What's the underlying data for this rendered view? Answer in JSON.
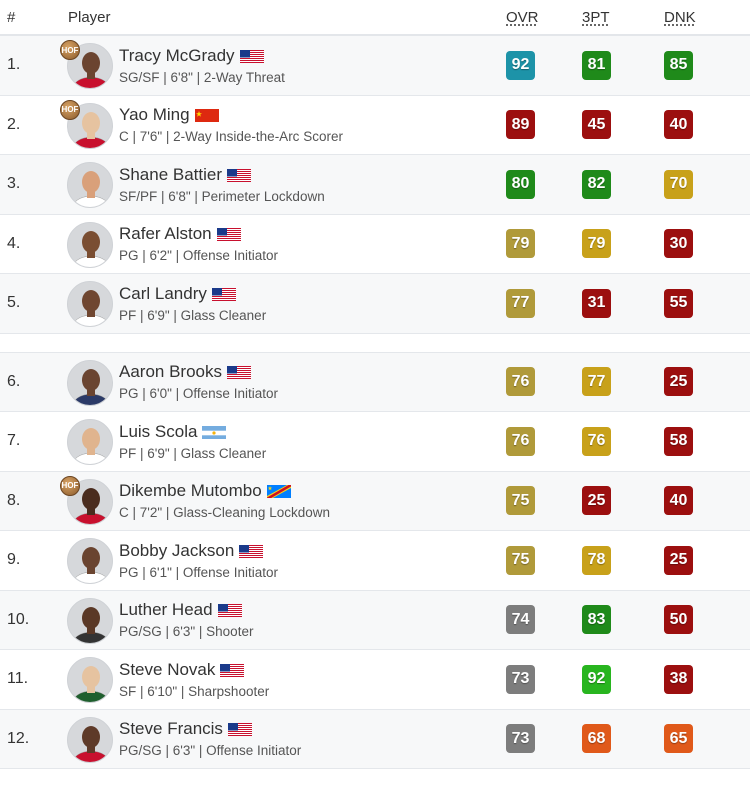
{
  "header": {
    "num": "#",
    "player": "Player",
    "ovr": "OVR",
    "threept": "3PT",
    "dnk": "DNK"
  },
  "colors": {
    "teal": "#1d93a8",
    "darkred": "#9c0f0f",
    "green": "#1f8a1a",
    "brightgreen": "#28b51f",
    "gold": "#b09a3a",
    "yellow": "#c8a11a",
    "gray": "#7d7d7d",
    "orange": "#e0591a"
  },
  "players": [
    {
      "rank": "1.",
      "name": "Tracy McGrady",
      "flag": "usa",
      "hof": true,
      "desc": "SG/SF | 6'8\" | 2-Way Threat",
      "ovr": "92",
      "ovr_c": "teal",
      "tpt": "81",
      "tpt_c": "green",
      "dnk": "85",
      "dnk_c": "green",
      "skin": "#6b4430",
      "jersey": "#c8102e"
    },
    {
      "rank": "2.",
      "name": "Yao Ming",
      "flag": "china",
      "hof": true,
      "desc": "C | 7'6\" | 2-Way Inside-the-Arc Scorer",
      "ovr": "89",
      "ovr_c": "darkred",
      "tpt": "45",
      "tpt_c": "darkred",
      "dnk": "40",
      "dnk_c": "darkred",
      "skin": "#e6c3a0",
      "jersey": "#c8102e"
    },
    {
      "rank": "3.",
      "name": "Shane Battier",
      "flag": "usa",
      "hof": false,
      "desc": "SF/PF | 6'8\" | Perimeter Lockdown",
      "ovr": "80",
      "ovr_c": "green",
      "tpt": "82",
      "tpt_c": "green",
      "dnk": "70",
      "dnk_c": "yellow",
      "skin": "#d9a07a",
      "jersey": "#ffffff"
    },
    {
      "rank": "4.",
      "name": "Rafer Alston",
      "flag": "usa",
      "hof": false,
      "desc": "PG | 6'2\" | Offense Initiator",
      "ovr": "79",
      "ovr_c": "gold",
      "tpt": "79",
      "tpt_c": "yellow",
      "dnk": "30",
      "dnk_c": "darkred",
      "skin": "#7a4e32",
      "jersey": "#ffffff"
    },
    {
      "rank": "5.",
      "name": "Carl Landry",
      "flag": "usa",
      "hof": false,
      "desc": "PF | 6'9\" | Glass Cleaner",
      "ovr": "77",
      "ovr_c": "gold",
      "tpt": "31",
      "tpt_c": "darkred",
      "dnk": "55",
      "dnk_c": "darkred",
      "skin": "#6f4630",
      "jersey": "#ffffff"
    },
    {
      "rank": "6.",
      "name": "Aaron Brooks",
      "flag": "usa",
      "hof": false,
      "desc": "PG | 6'0\" | Offense Initiator",
      "ovr": "76",
      "ovr_c": "gold",
      "tpt": "77",
      "tpt_c": "yellow",
      "dnk": "25",
      "dnk_c": "darkred",
      "skin": "#6a4430",
      "jersey": "#2b3a67"
    },
    {
      "rank": "7.",
      "name": "Luis Scola",
      "flag": "argentina",
      "hof": false,
      "desc": "PF | 6'9\" | Glass Cleaner",
      "ovr": "76",
      "ovr_c": "gold",
      "tpt": "76",
      "tpt_c": "yellow",
      "dnk": "58",
      "dnk_c": "darkred",
      "skin": "#e0b48e",
      "jersey": "#ffffff"
    },
    {
      "rank": "8.",
      "name": "Dikembe Mutombo",
      "flag": "congo",
      "hof": true,
      "desc": "C | 7'2\" | Glass-Cleaning Lockdown",
      "ovr": "75",
      "ovr_c": "gold",
      "tpt": "25",
      "tpt_c": "darkred",
      "dnk": "40",
      "dnk_c": "darkred",
      "skin": "#4a2c1e",
      "jersey": "#c8102e"
    },
    {
      "rank": "9.",
      "name": "Bobby Jackson",
      "flag": "usa",
      "hof": false,
      "desc": "PG | 6'1\" | Offense Initiator",
      "ovr": "75",
      "ovr_c": "gold",
      "tpt": "78",
      "tpt_c": "yellow",
      "dnk": "25",
      "dnk_c": "darkred",
      "skin": "#6a4430",
      "jersey": "#ffffff"
    },
    {
      "rank": "10.",
      "name": "Luther Head",
      "flag": "usa",
      "hof": false,
      "desc": "PG/SG | 6'3\" | Shooter",
      "ovr": "74",
      "ovr_c": "gray",
      "tpt": "83",
      "tpt_c": "green",
      "dnk": "50",
      "dnk_c": "darkred",
      "skin": "#5a3826",
      "jersey": "#333333"
    },
    {
      "rank": "11.",
      "name": "Steve Novak",
      "flag": "usa",
      "hof": false,
      "desc": "SF | 6'10\" | Sharpshooter",
      "ovr": "73",
      "ovr_c": "gray",
      "tpt": "92",
      "tpt_c": "brightgreen",
      "dnk": "38",
      "dnk_c": "darkred",
      "skin": "#e6c3a0",
      "jersey": "#1f5f2e"
    },
    {
      "rank": "12.",
      "name": "Steve Francis",
      "flag": "usa",
      "hof": false,
      "desc": "PG/SG | 6'3\" | Offense Initiator",
      "ovr": "73",
      "ovr_c": "gray",
      "tpt": "68",
      "tpt_c": "orange",
      "dnk": "65",
      "dnk_c": "orange",
      "skin": "#5e3a28",
      "jersey": "#c8102e"
    }
  ]
}
